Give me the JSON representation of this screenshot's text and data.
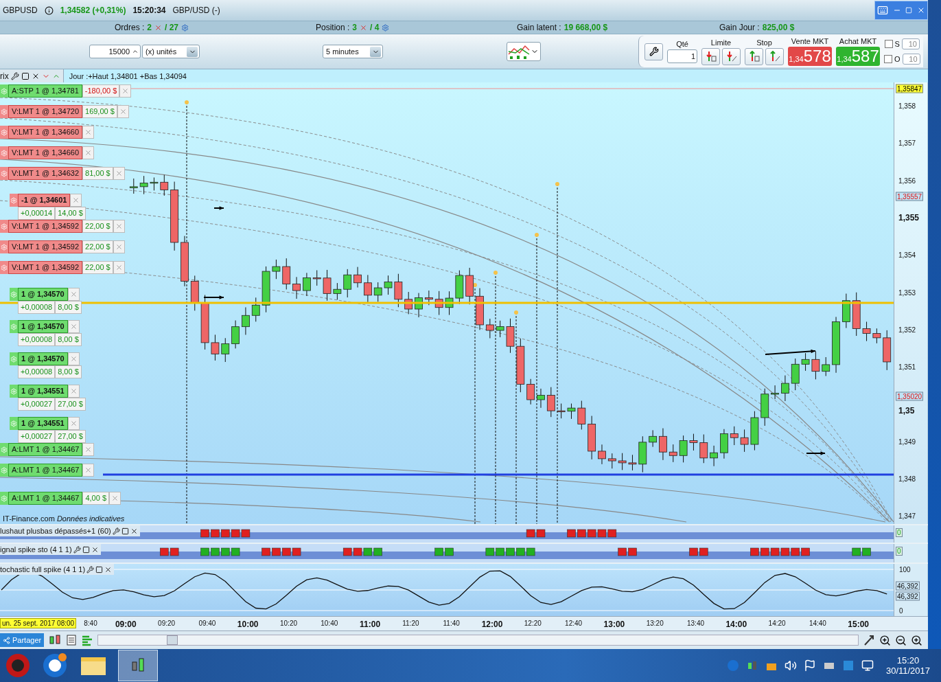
{
  "title_bar": {
    "symbol": "GBPUSD",
    "price": "1,34582 (+0,31%)",
    "time": "15:20:34",
    "name": "GBP/USD (-)"
  },
  "info_bar": {
    "orders": {
      "label": "Ordres :",
      "count": "2",
      "total": "/ 27"
    },
    "position": {
      "label": "Position :",
      "count": "3",
      "total": "/ 4"
    },
    "gain_latent": {
      "label": "Gain latent :",
      "value": "19 668,00 $"
    },
    "gain_jour": {
      "label": "Gain Jour :",
      "value": "825,00 $"
    }
  },
  "toolbar": {
    "quantity": "15000",
    "unit": "(x) unités",
    "interval": "5 minutes"
  },
  "order_panel": {
    "qty_label": "Qté",
    "qty": "1",
    "limit_label": "Limite",
    "stop_label": "Stop",
    "sell": {
      "label": "Vente MKT",
      "prefix": "1,34",
      "price": "578"
    },
    "buy": {
      "label": "Achat MKT",
      "prefix": "1,34",
      "price": "587"
    },
    "options": [
      {
        "label": "S",
        "checked": false,
        "value": "10"
      },
      {
        "label": "O",
        "checked": false,
        "value": "10"
      }
    ]
  },
  "chart": {
    "header_label": "rix",
    "day_range": "Jour :+Haut 1,34801 +Bas 1,34094",
    "source": "IT-Finance.com",
    "disclaimer": "Données indicatives",
    "orders": [
      {
        "kind": "order",
        "text": "A:STP 1 @ 1,34781",
        "pnl": "-180,00 $",
        "pnl_negative": true,
        "color": "#6fdc6f"
      },
      {
        "kind": "order",
        "text": "V:LMT 1 @ 1,34720",
        "pnl": "169,00 $",
        "pnl_negative": false,
        "color": "#f08a8a"
      },
      {
        "kind": "order",
        "text": "V:LMT 1 @ 1,34660",
        "color": "#f08a8a"
      },
      {
        "kind": "order",
        "text": "V:LMT 1 @ 1,34660",
        "color": "#f08a8a"
      },
      {
        "kind": "order",
        "text": "V:LMT 1 @ 1,34632",
        "pnl": "81,00 $",
        "pnl_negative": false,
        "color": "#f08a8a"
      },
      {
        "kind": "position",
        "text": "-1 @ 1,34601",
        "delta": "+0,00014",
        "pnl": "14,00 $",
        "color": "#f08a8a"
      },
      {
        "kind": "order",
        "text": "V:LMT 1 @ 1,34592",
        "pnl": "22,00 $",
        "pnl_negative": false,
        "color": "#f08a8a"
      },
      {
        "kind": "order",
        "text": "V:LMT 1 @ 1,34592",
        "pnl": "22,00 $",
        "pnl_negative": false,
        "color": "#f08a8a"
      },
      {
        "kind": "order",
        "text": "V:LMT 1 @ 1,34592",
        "pnl": "22,00 $",
        "pnl_negative": false,
        "color": "#f08a8a"
      },
      {
        "kind": "position",
        "text": "1 @ 1,34570",
        "delta": "+0,00008",
        "pnl": "8,00 $",
        "color": "#6fdc6f"
      },
      {
        "kind": "position",
        "text": "1 @ 1,34570",
        "delta": "+0,00008",
        "pnl": "8,00 $",
        "color": "#6fdc6f"
      },
      {
        "kind": "position",
        "text": "1 @ 1,34570",
        "delta": "+0,00008",
        "pnl": "8,00 $",
        "color": "#6fdc6f"
      },
      {
        "kind": "position",
        "text": "1 @ 1,34551",
        "delta": "+0,00027",
        "pnl": "27,00 $",
        "color": "#6fdc6f"
      },
      {
        "kind": "position",
        "text": "1 @ 1,34551",
        "delta": "+0,00027",
        "pnl": "27,00 $",
        "color": "#6fdc6f"
      },
      {
        "kind": "order",
        "text": "A:LMT 1 @ 1,34467",
        "color": "#6fdc6f"
      },
      {
        "kind": "order",
        "text": "A:LMT 1 @ 1,34467",
        "color": "#6fdc6f"
      },
      {
        "kind": "order",
        "text": "A:LMT 1 @ 1,34467",
        "pnl": "4,00 $",
        "pnl_negative": false,
        "color": "#6fdc6f"
      }
    ],
    "axis": {
      "ticks": [
        {
          "label": "1,358",
          "major": false
        },
        {
          "label": "1,357",
          "major": false
        },
        {
          "label": "1,356",
          "major": false
        },
        {
          "label": "1,355",
          "major": true
        },
        {
          "label": "1,354",
          "major": false
        },
        {
          "label": "1,353",
          "major": false
        },
        {
          "label": "1,352",
          "major": false
        },
        {
          "label": "1,351",
          "major": false
        },
        {
          "label": "1,35",
          "major": true
        },
        {
          "label": "1,349",
          "major": false
        },
        {
          "label": "1,348",
          "major": false
        },
        {
          "label": "1,347",
          "major": false
        }
      ],
      "markers": [
        {
          "label": "1,35847",
          "kind": "last"
        },
        {
          "label": "1,35557",
          "kind": "alert"
        },
        {
          "label": "1,35020",
          "kind": "alert"
        }
      ]
    }
  },
  "indicators": [
    {
      "title": "lushaut plusbas dépassés+1 (60)",
      "value": "0"
    },
    {
      "title": "ignal spike sto (4 1 1)",
      "value": "0"
    }
  ],
  "stochastic": {
    "title": "tochastic full spike (4 1 1)",
    "scale": [
      "100",
      "46,392",
      "46,392",
      "0"
    ]
  },
  "time_axis": {
    "start": "un. 25 sept. 2017 08:00",
    "ticks": [
      {
        "label": "8:40",
        "major": false
      },
      {
        "label": "09:00",
        "major": true
      },
      {
        "label": "09:20",
        "major": false
      },
      {
        "label": "09:40",
        "major": false
      },
      {
        "label": "10:00",
        "major": true
      },
      {
        "label": "10:20",
        "major": false
      },
      {
        "label": "10:40",
        "major": false
      },
      {
        "label": "11:00",
        "major": true
      },
      {
        "label": "11:20",
        "major": false
      },
      {
        "label": "11:40",
        "major": false
      },
      {
        "label": "12:00",
        "major": true
      },
      {
        "label": "12:20",
        "major": false
      },
      {
        "label": "12:40",
        "major": false
      },
      {
        "label": "13:00",
        "major": true
      },
      {
        "label": "13:20",
        "major": false
      },
      {
        "label": "13:40",
        "major": false
      },
      {
        "label": "14:00",
        "major": true
      },
      {
        "label": "14:20",
        "major": false
      },
      {
        "label": "14:40",
        "major": false
      },
      {
        "label": "15:00",
        "major": true
      }
    ]
  },
  "bottom_bar": {
    "share": "Partager"
  },
  "taskbar": {
    "time": "15:20",
    "date": "30/11/2017"
  }
}
